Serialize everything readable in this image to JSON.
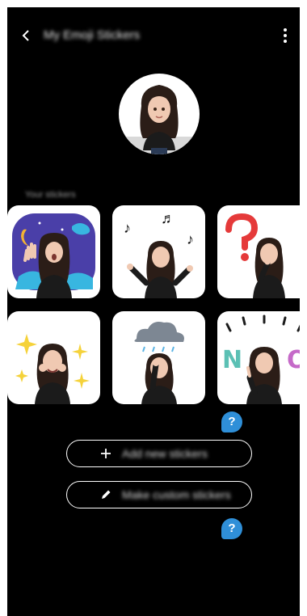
{
  "header": {
    "title": "My Emoji Stickers",
    "back_icon": "chevron-left-icon",
    "more_icon": "more-vertical-icon"
  },
  "profile": {
    "avatar_icon": "emoji-avatar"
  },
  "section_label": "Your stickers",
  "stickers": [
    {
      "theme": "night-sky-yawn"
    },
    {
      "theme": "music-dance"
    },
    {
      "theme": "question-thinking"
    },
    {
      "theme": "sparkle-happy"
    },
    {
      "theme": "rain-cloud-sad"
    },
    {
      "theme": "no-gesture"
    }
  ],
  "help_badge_label": "?",
  "buttons": {
    "add_new_label": "Add new stickers",
    "make_custom_label": "Make custom stickers"
  },
  "colors": {
    "background": "#000000",
    "tile": "#ffffff",
    "accent": "#2f8fd8"
  }
}
